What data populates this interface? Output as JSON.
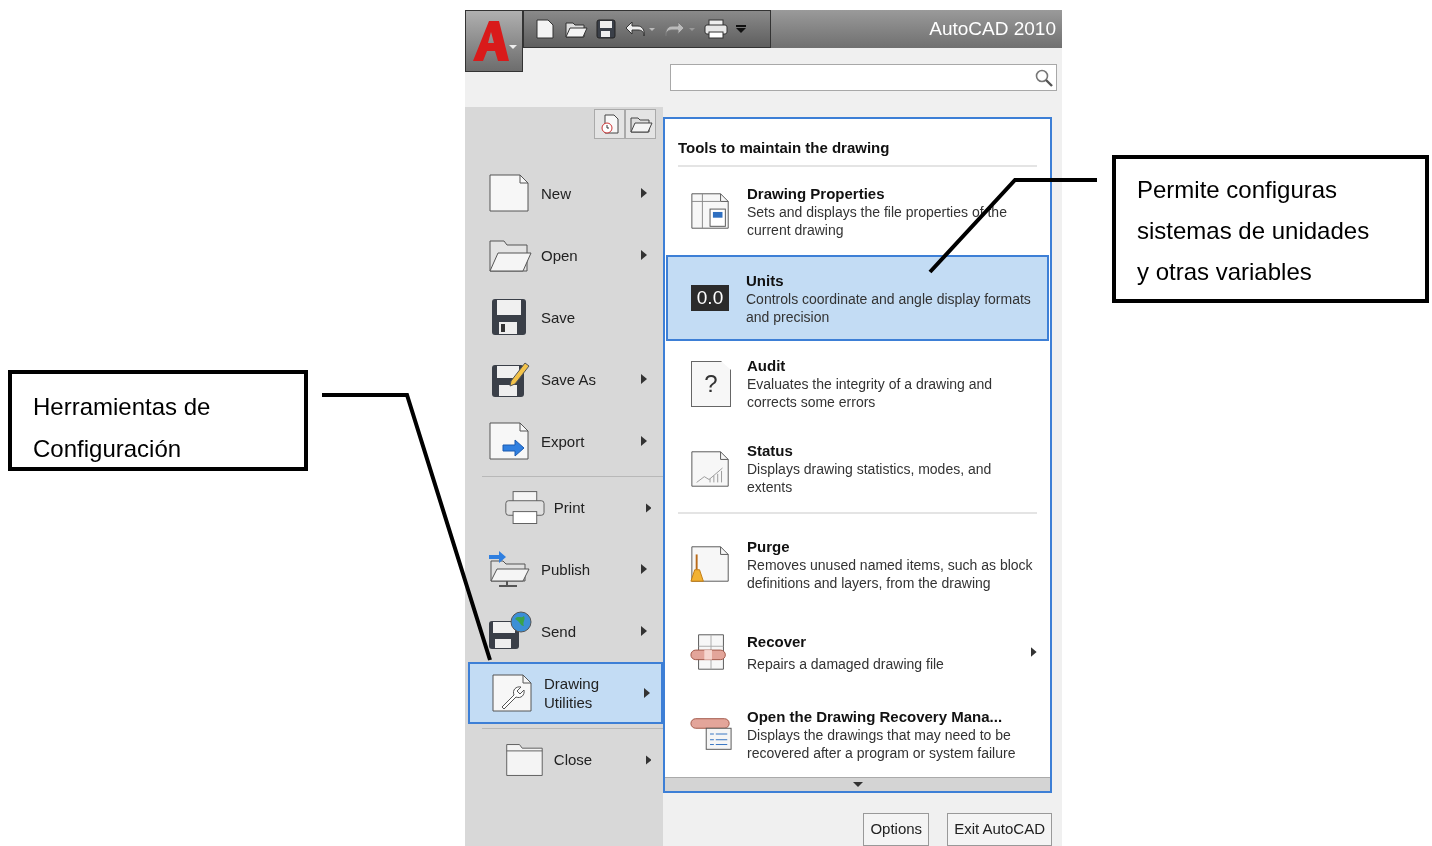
{
  "window": {
    "title": "AutoCAD 2010"
  },
  "left_menu": {
    "items": [
      {
        "label": "New",
        "has_submenu": true,
        "selected": false,
        "divider_before": false
      },
      {
        "label": "Open",
        "has_submenu": true,
        "selected": false,
        "divider_before": false
      },
      {
        "label": "Save",
        "has_submenu": false,
        "selected": false,
        "divider_before": false
      },
      {
        "label": "Save As",
        "has_submenu": true,
        "selected": false,
        "divider_before": false
      },
      {
        "label": "Export",
        "has_submenu": true,
        "selected": false,
        "divider_before": false
      },
      {
        "label": "Print",
        "has_submenu": true,
        "selected": false,
        "divider_before": true
      },
      {
        "label": "Publish",
        "has_submenu": true,
        "selected": false,
        "divider_before": false
      },
      {
        "label": "Send",
        "has_submenu": true,
        "selected": false,
        "divider_before": false
      },
      {
        "label": "Drawing Utilities",
        "has_submenu": true,
        "selected": true,
        "divider_before": false
      },
      {
        "label": "Close",
        "has_submenu": true,
        "selected": false,
        "divider_before": true
      }
    ]
  },
  "submenu": {
    "header": "Tools to maintain the drawing",
    "items": [
      {
        "title": "Drawing Properties",
        "description": "Sets and displays the file properties of the current drawing",
        "selected": false,
        "has_submenu": false,
        "divider_before": false
      },
      {
        "title": "Units",
        "description": "Controls coordinate and angle display formats and precision",
        "icon_text": "0.0",
        "selected": true,
        "has_submenu": false,
        "divider_before": false
      },
      {
        "title": "Audit",
        "description": "Evaluates the integrity of a drawing and corrects some errors",
        "icon_text": "?",
        "selected": false,
        "has_submenu": false,
        "divider_before": false
      },
      {
        "title": "Status",
        "description": "Displays drawing statistics, modes, and extents",
        "selected": false,
        "has_submenu": false,
        "divider_before": false
      },
      {
        "title": "Purge",
        "description": "Removes unused named items, such as block definitions and layers, from the drawing",
        "selected": false,
        "has_submenu": false,
        "divider_before": true
      },
      {
        "title": "Recover",
        "description": "Repairs a damaged drawing file",
        "selected": false,
        "has_submenu": true,
        "divider_before": false
      },
      {
        "title": "Open the Drawing Recovery Mana...",
        "description": "Displays the drawings that may need to be recovered after a program or system failure",
        "selected": false,
        "has_submenu": false,
        "divider_before": false
      }
    ]
  },
  "footer_buttons": [
    "Options",
    "Exit AutoCAD"
  ],
  "callouts": [
    {
      "text": "Herramientas de Configuración"
    },
    {
      "text": "Permite configuras sistemas de unidades y otras variables"
    }
  ]
}
